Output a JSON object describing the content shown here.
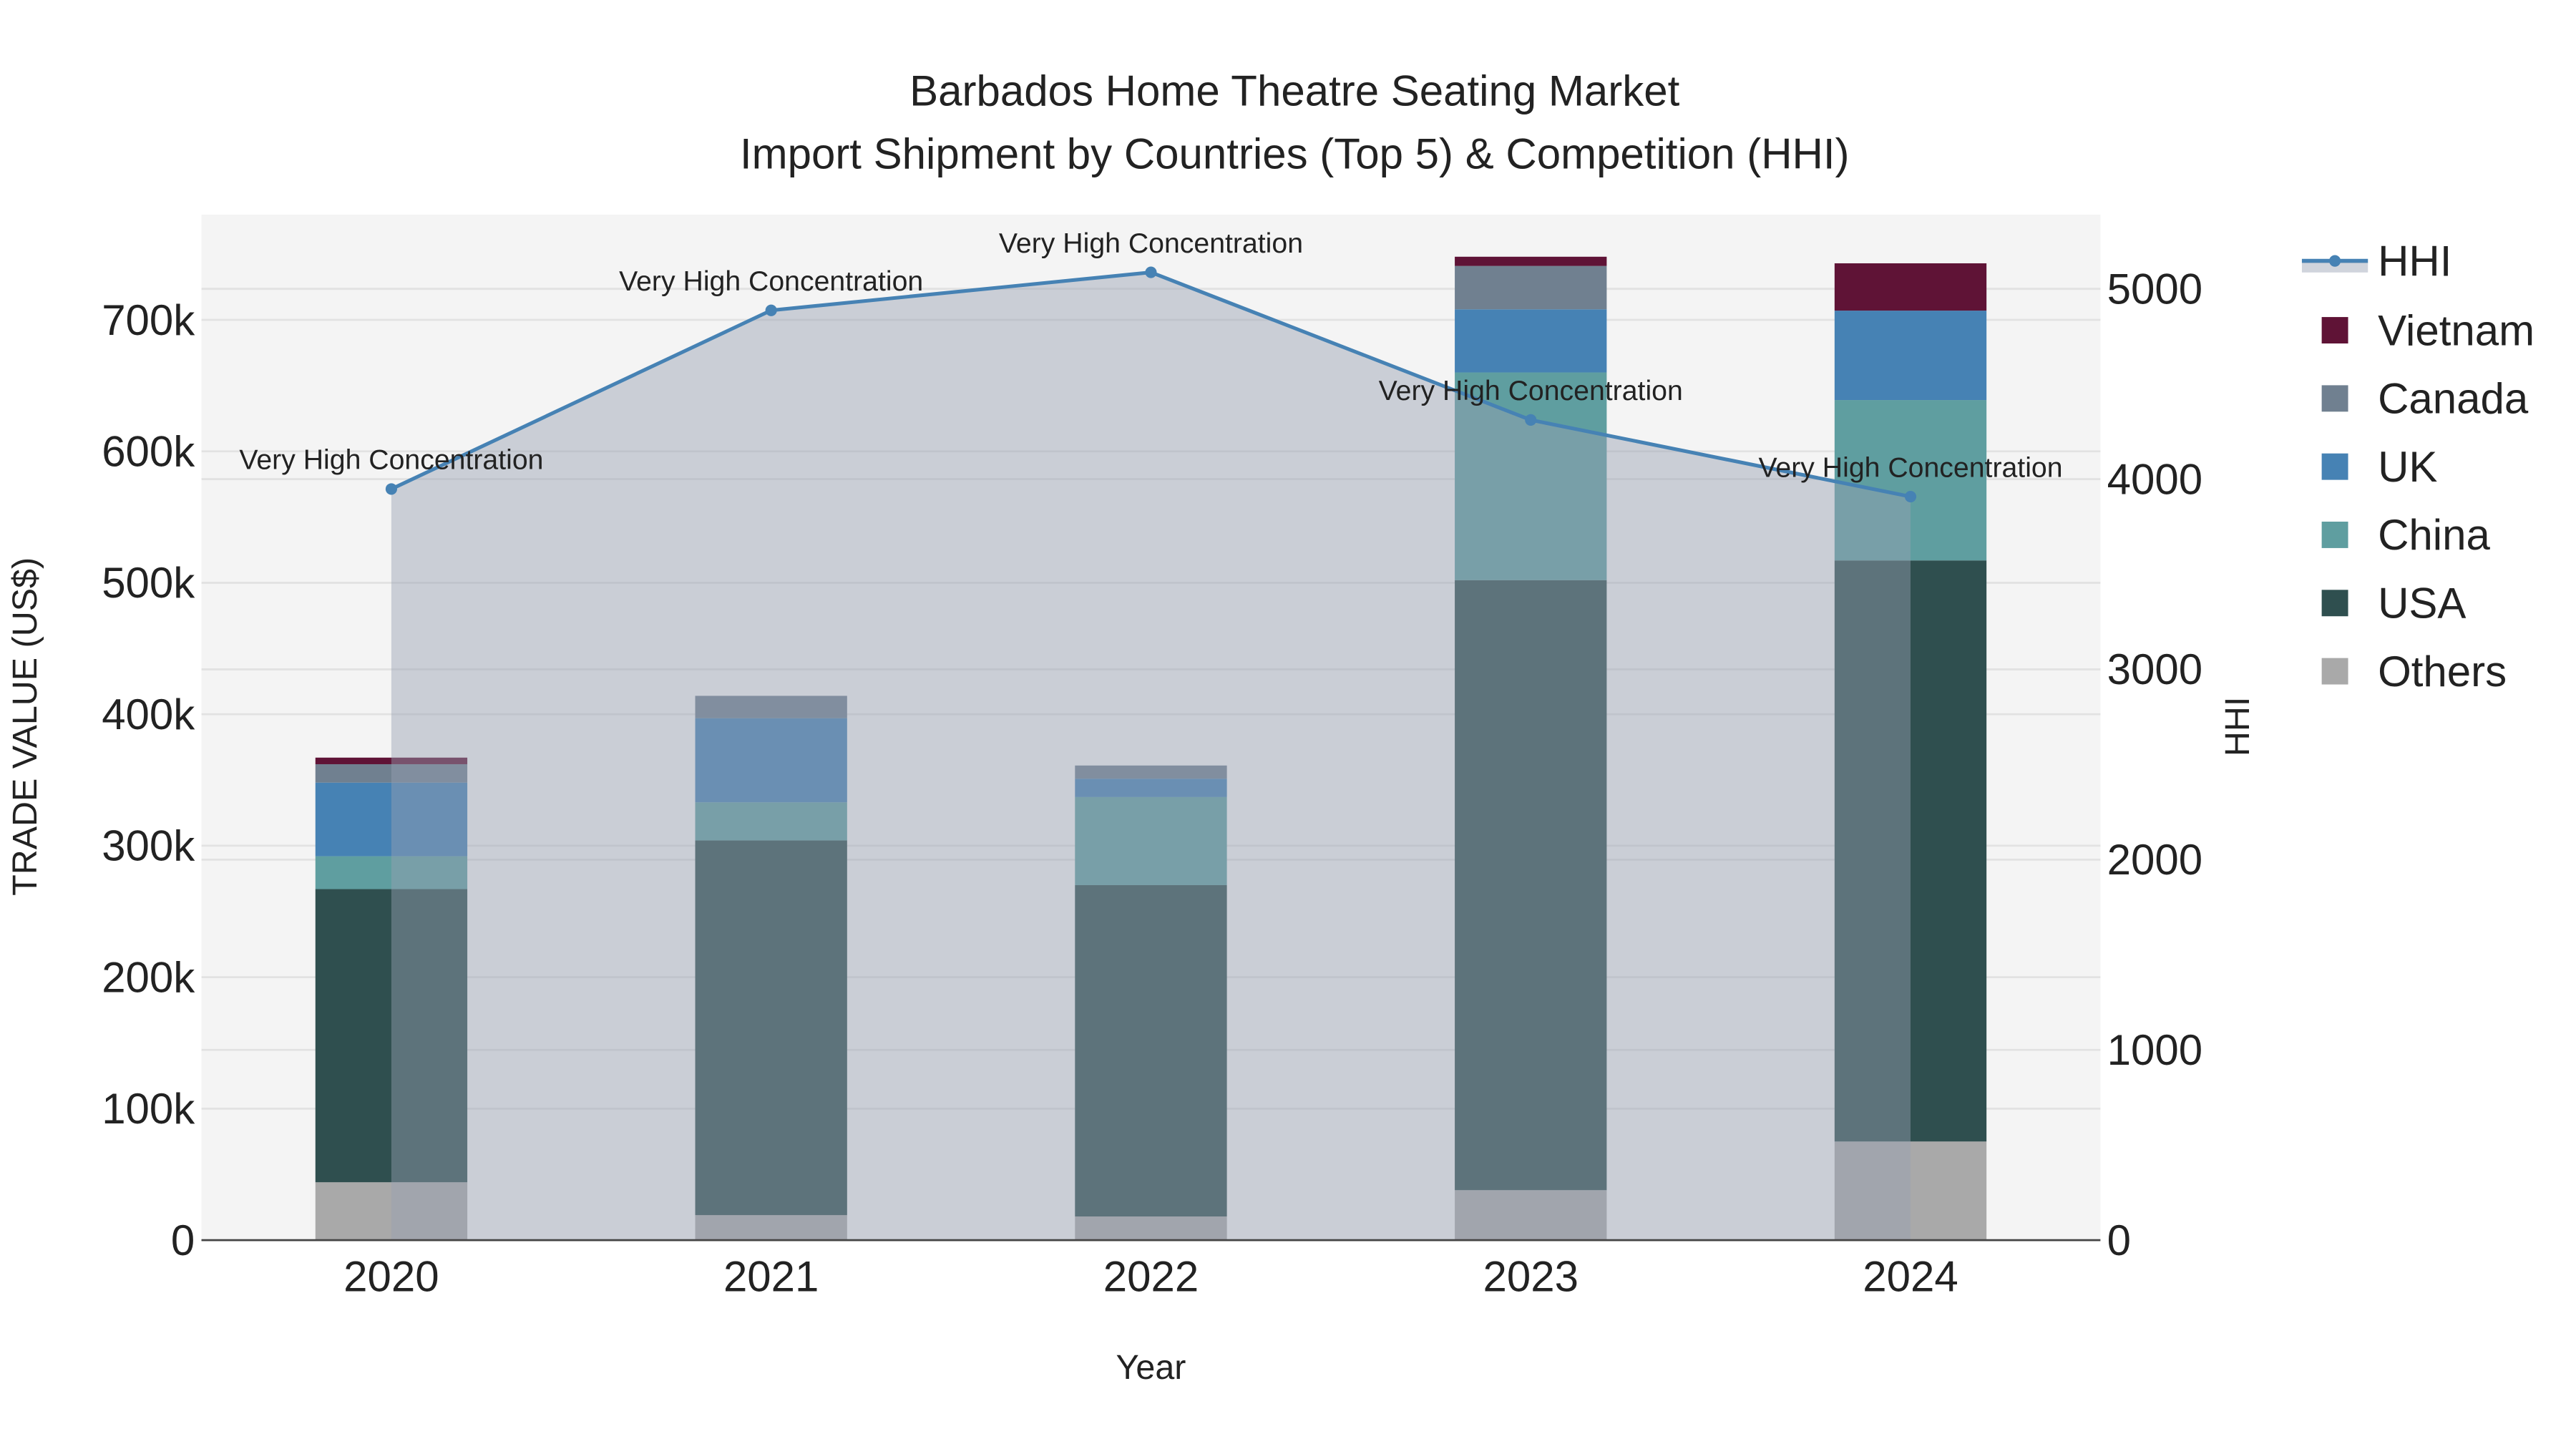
{
  "chart_data": {
    "type": "bar",
    "stacked": true,
    "title_line1": "Barbados Home Theatre Seating Market",
    "title_line2": "Import Shipment by Countries (Top 5) & Competition (HHI)",
    "xlabel": "Year",
    "ylabel": "TRADE VALUE (US$)",
    "y2label": "HHI",
    "categories": [
      "2020",
      "2021",
      "2022",
      "2023",
      "2024"
    ],
    "ylim": [
      0,
      780000
    ],
    "y_ticks": [
      0,
      100000,
      200000,
      300000,
      400000,
      500000,
      600000,
      700000
    ],
    "y_tick_labels": [
      "0",
      "100k",
      "200k",
      "300k",
      "400k",
      "500k",
      "600k",
      "700k"
    ],
    "y2lim": [
      0,
      5390
    ],
    "y2_ticks": [
      0,
      1000,
      2000,
      3000,
      4000,
      5000
    ],
    "y2_tick_labels": [
      "0",
      "1000",
      "2000",
      "3000",
      "4000",
      "5000"
    ],
    "legend_placement": "right",
    "series": [
      {
        "name": "Others",
        "color": "#a9a9a9",
        "values": [
          44000,
          19000,
          18000,
          38000,
          75000
        ]
      },
      {
        "name": "USA",
        "color": "#2f4f4f",
        "values": [
          223000,
          285000,
          252000,
          464000,
          442000
        ]
      },
      {
        "name": "China",
        "color": "#5f9ea0",
        "values": [
          25000,
          29000,
          67000,
          158000,
          122000
        ]
      },
      {
        "name": "UK",
        "color": "#4682b4",
        "values": [
          56000,
          64000,
          14000,
          48000,
          68000
        ]
      },
      {
        "name": "Canada",
        "color": "#708090",
        "values": [
          14000,
          17000,
          10000,
          33000,
          0
        ]
      },
      {
        "name": "Vietnam",
        "color": "#5f1336",
        "values": [
          5000,
          0,
          0,
          7000,
          36000
        ]
      }
    ],
    "hhi": {
      "name": "HHI",
      "color": "#4682b4",
      "values": [
        3948,
        4887,
        5087,
        4311,
        3908
      ],
      "annotations": [
        "Very High Concentration",
        "Very High Concentration",
        "Very High Concentration",
        "Very High Concentration",
        "Very High Concentration"
      ]
    }
  }
}
